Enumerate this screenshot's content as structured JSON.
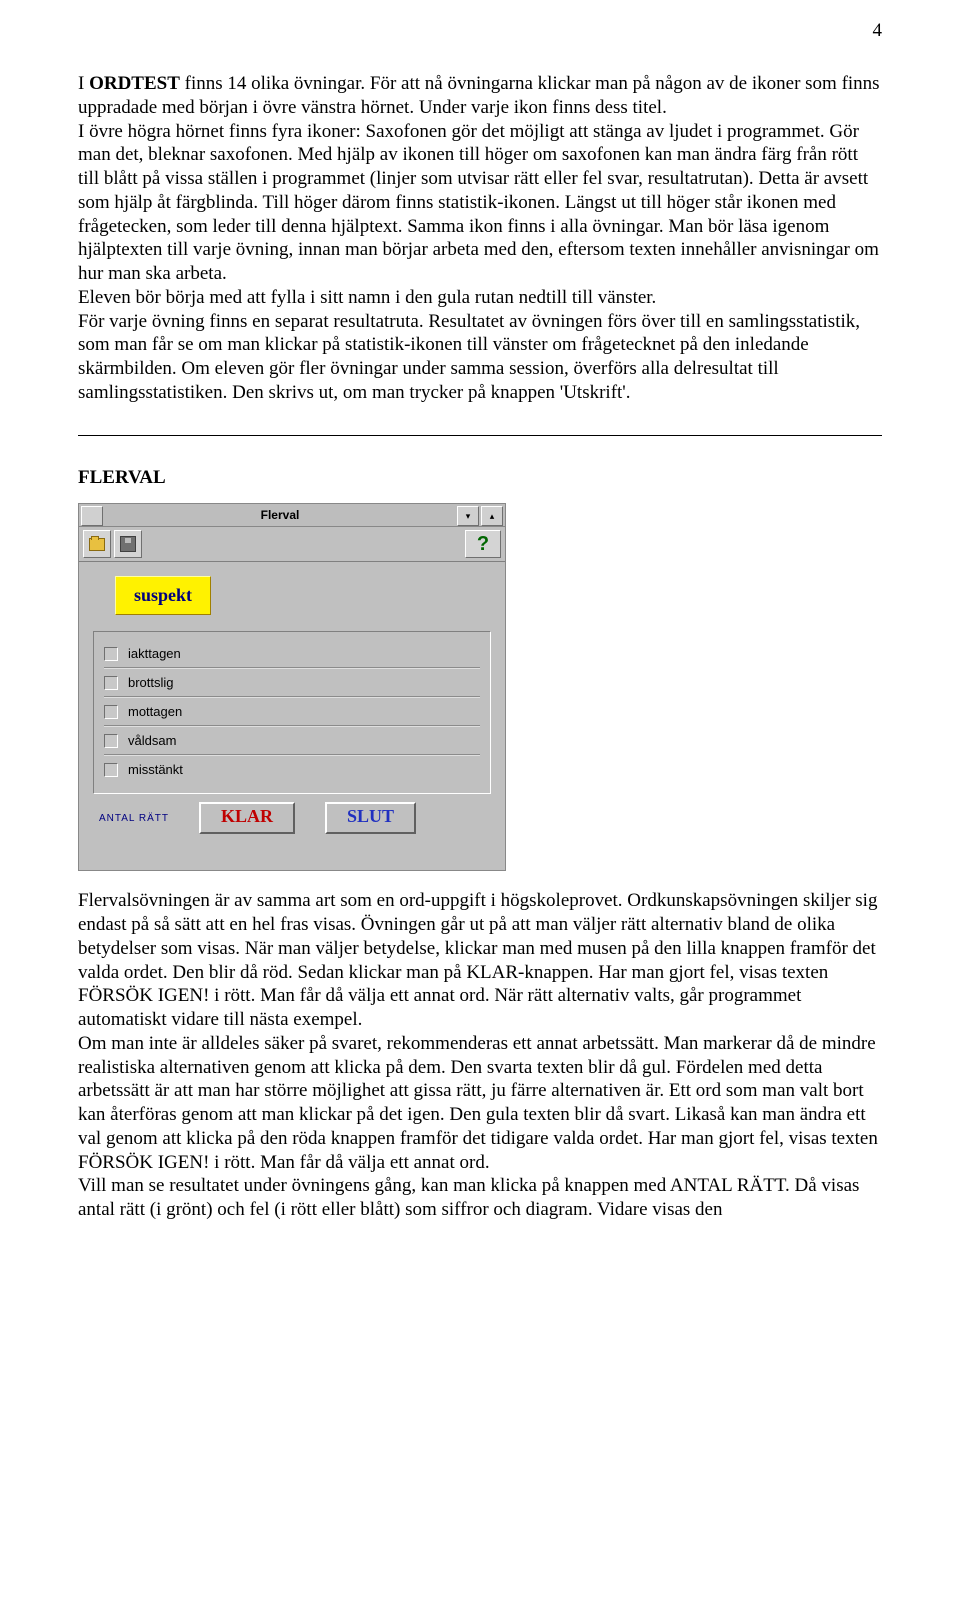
{
  "page_number": "4",
  "intro": {
    "prefix": "I ",
    "bold1": "ORDTEST",
    "after_bold1": " finns 14 olika övningar. För att nå övningarna klickar man på någon av de ikoner som finns uppradade med början i övre vänstra hörnet. Under varje ikon finns dess titel.",
    "p2": "I övre högra hörnet finns fyra ikoner: Saxofonen gör det möjligt att stänga av ljudet i programmet. Gör man det, bleknar saxofonen. Med hjälp av ikonen till höger om saxofonen kan man ändra färg från rött till blått på vissa ställen i programmet (linjer som utvisar rätt eller fel svar, resultatrutan). Detta är avsett som hjälp åt färgblinda. Till höger därom finns statistik-ikonen. Längst ut till höger står ikonen med frågetecken, som leder till denna hjälptext. Samma ikon finns i alla övningar. Man bör läsa igenom hjälptexten till varje övning, innan man börjar arbeta med den, eftersom texten innehåller anvisningar om hur man ska arbeta.",
    "p3": "Eleven bör börja med att fylla i sitt namn i den gula rutan nedtill till vänster.",
    "p4": "För varje övning finns en separat resultatruta. Resultatet av övningen förs över till en samlingsstatistik, som man får se om man klickar på statistik-ikonen till vänster om frågetecknet på den inledande skärmbilden. Om eleven gör fler övningar under samma session, överförs alla delresultat till samlingsstatistiken. Den skrivs ut, om man trycker på knappen 'Utskrift'."
  },
  "flerval": {
    "heading": "FLERVAL",
    "app": {
      "title": "Flerval",
      "word": "suspekt",
      "options": [
        "iakttagen",
        "brottslig",
        "mottagen",
        "våldsam",
        "misstänkt"
      ],
      "antal": "ANTAL RÄTT",
      "klar": "KLAR",
      "slut": "SLUT",
      "help": "?"
    },
    "p1": "Flervalsövningen är av samma art som en ord-uppgift i högskoleprovet. Ordkunskapsövningen skiljer sig endast på så sätt att en hel fras visas. Övningen går ut på att man väljer rätt alternativ bland de olika betydelser som visas. När man väljer betydelse, klickar man med musen på den lilla knappen framför det valda ordet. Den blir då röd. Sedan klickar man på KLAR-knappen. Har man gjort fel, visas texten FÖRSÖK IGEN! i rött. Man får då välja ett annat ord. När rätt alternativ valts, går programmet automatiskt vidare till nästa exempel.",
    "p2": "Om man inte är alldeles säker på svaret, rekommenderas ett annat arbetssätt. Man markerar då de mindre realistiska alternativen genom att klicka på dem. Den svarta texten blir då gul. Fördelen med detta arbetssätt är att man har större möjlighet att gissa rätt, ju färre alternativen är. Ett ord som man valt bort kan återföras genom att man klickar på det igen. Den gula texten blir då svart. Likaså kan man ändra ett val genom att klicka på den röda knappen framför det tidigare valda ordet. Har man gjort fel, visas texten FÖRSÖK IGEN! i rött. Man får då välja ett annat ord.",
    "p3": "Vill man se resultatet under övningens gång, kan man klicka på knappen med ANTAL RÄTT. Då visas antal rätt (i grönt) och fel (i rött eller blått) som siffror och diagram. Vidare visas den"
  }
}
